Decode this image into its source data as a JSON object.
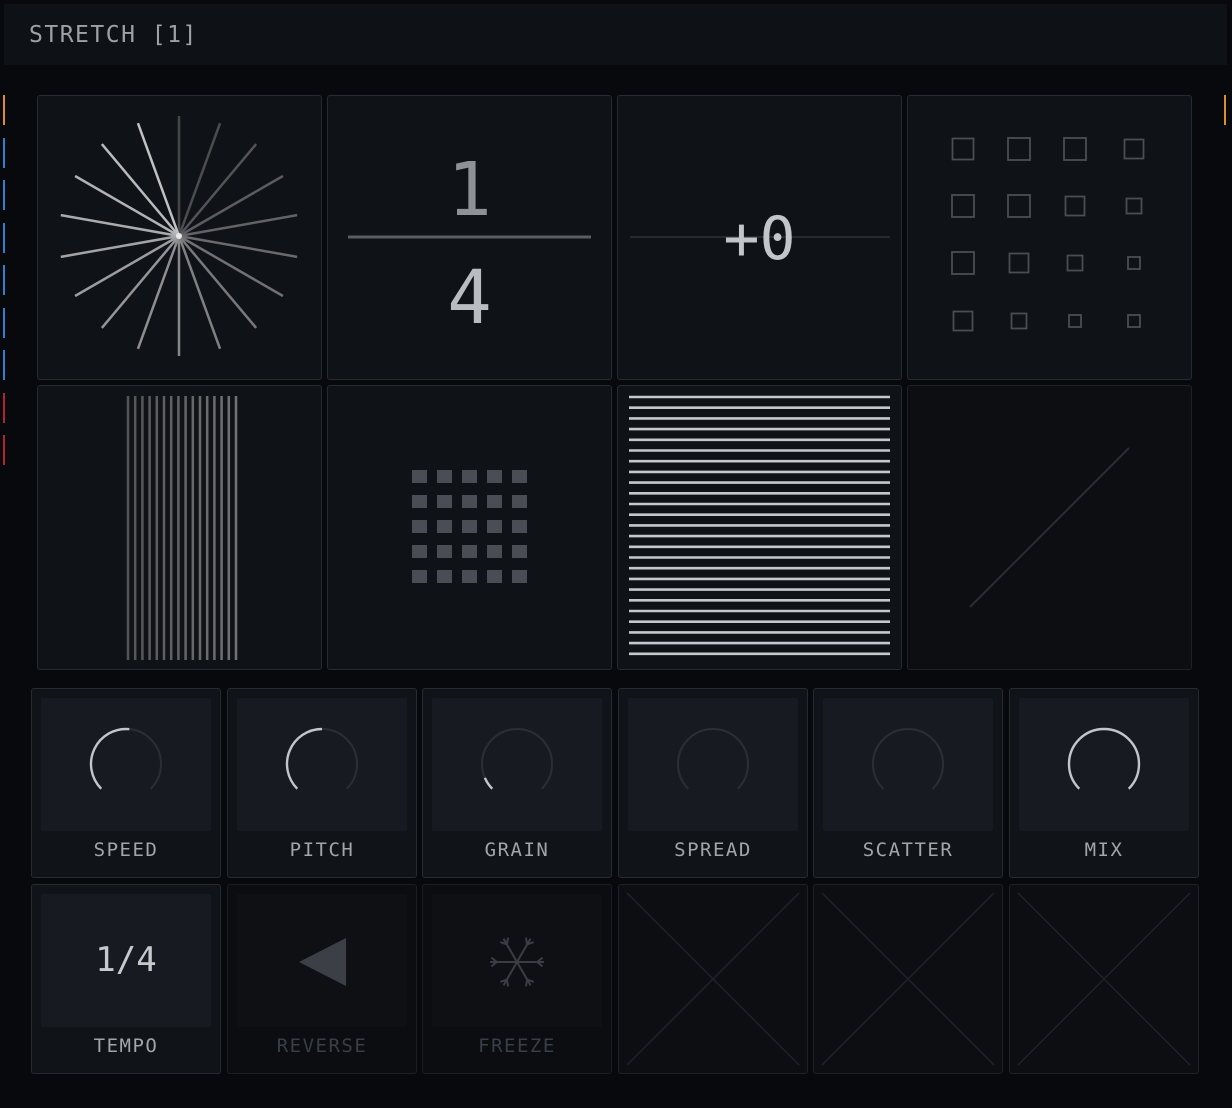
{
  "header": {
    "title": "STRETCH [1]"
  },
  "colors": {
    "accent_orange": "#d9902b",
    "accent_blue": "#2f7fd0",
    "accent_red": "#b3232d",
    "background": "#07090c",
    "tile": "#0f1216"
  },
  "side_marks": [
    "orange",
    "blue",
    "blue",
    "blue",
    "blue",
    "blue",
    "blue",
    "red",
    "red"
  ],
  "visualizers": {
    "fraction": {
      "numerator": "1",
      "denominator": "4"
    },
    "offset": {
      "value": "+0"
    }
  },
  "knobs": [
    {
      "label": "SPEED",
      "value": 0.52
    },
    {
      "label": "PITCH",
      "value": 0.5
    },
    {
      "label": "GRAIN",
      "value": 0.08
    },
    {
      "label": "SPREAD",
      "value": 0
    },
    {
      "label": "SCATTER",
      "value": 0
    },
    {
      "label": "MIX",
      "value": 1.0
    }
  ],
  "buttons": [
    {
      "label": "TEMPO",
      "value": "1/4",
      "icon": "tempo-display",
      "enabled": true
    },
    {
      "label": "REVERSE",
      "icon": "reverse-triangle-icon",
      "enabled": false
    },
    {
      "label": "FREEZE",
      "icon": "snowflake-icon",
      "enabled": false
    }
  ]
}
